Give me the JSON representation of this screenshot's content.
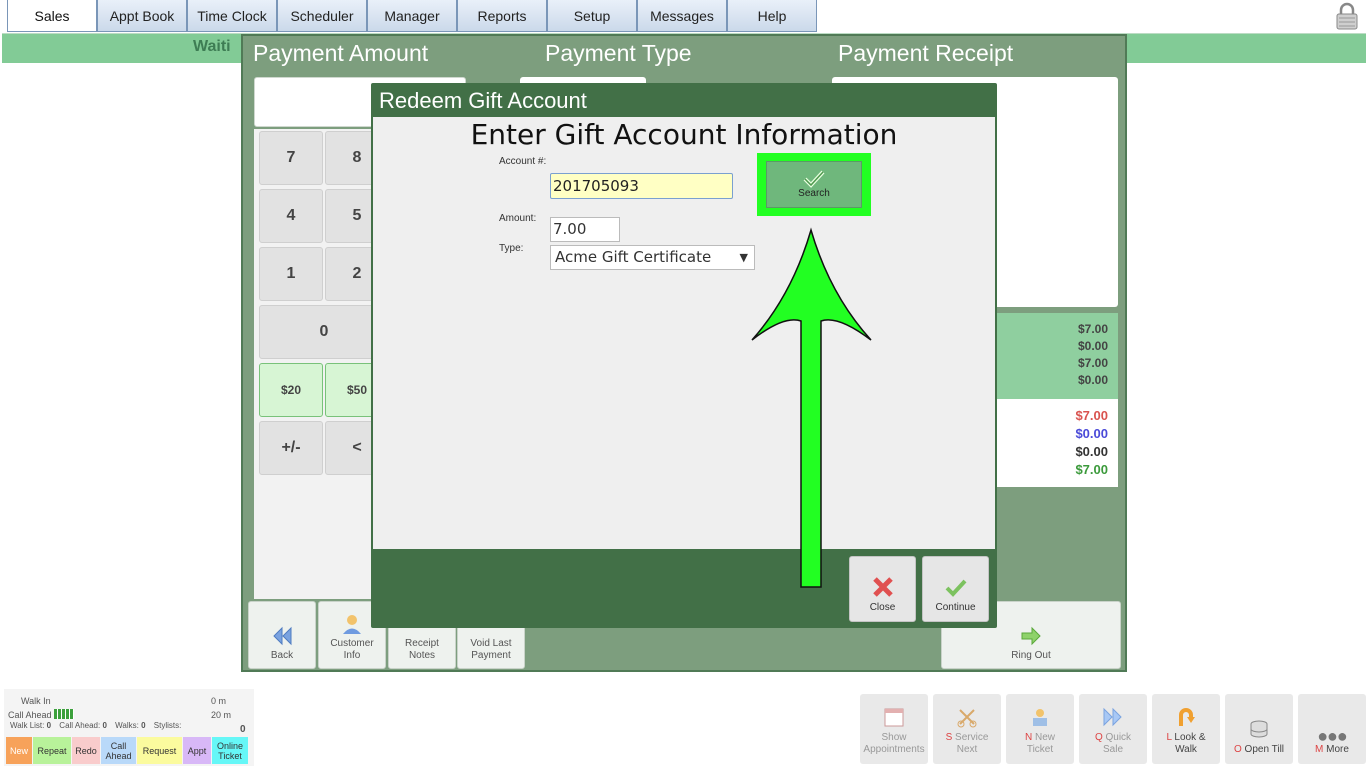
{
  "tabs": [
    "Sales",
    "Appt Book",
    "Time Clock",
    "Scheduler",
    "Manager",
    "Reports",
    "Setup",
    "Messages",
    "Help"
  ],
  "waiting_label": "Waiti",
  "payment": {
    "amount_header": "Payment Amount",
    "type_header": "Payment Type",
    "receipt_header": "Payment Receipt",
    "keys": [
      "7",
      "8",
      "4",
      "5",
      "1",
      "2",
      "0",
      "$20",
      "$50",
      "+/-",
      "<"
    ],
    "summary_green": [
      "$7.00",
      "$0.00",
      "$7.00",
      "$0.00"
    ],
    "summary_white": [
      "$7.00",
      "$0.00",
      "$0.00",
      "$7.00"
    ],
    "actions": {
      "back": "Back",
      "customer_info": [
        "Customer",
        "Info"
      ],
      "receipt_notes": [
        "Receipt",
        "Notes"
      ],
      "void_last": [
        "Void Last",
        "Payment"
      ],
      "ring_out": "Ring Out"
    }
  },
  "modal": {
    "title": "Redeem Gift Account",
    "heading": "Enter Gift Account Information",
    "account_label": "Account #:",
    "account_value": "201705093",
    "amount_label": "Amount:",
    "amount_value": "7.00",
    "type_label": "Type:",
    "type_value": "Acme Gift Certificate",
    "search_label": "Search",
    "close_label": "Close",
    "continue_label": "Continue"
  },
  "status": {
    "walk_in": "Walk In",
    "walk_in_time": "0 m",
    "call_ahead": "Call Ahead",
    "call_ahead_time": "20 m",
    "walk_list": "Walk List:",
    "walk_list_count": "0",
    "call_ahead_count_label": "Call Ahead:",
    "call_ahead_count": "0",
    "walks": "Walks:",
    "walks_count": "0",
    "stylists": "Stylists:",
    "total": "0"
  },
  "chips": [
    "New",
    "Repeat",
    "Redo",
    "Call Ahead",
    "Request",
    "Appt",
    "Online Ticket"
  ],
  "bottom_buttons": {
    "show_appts": [
      "Show",
      "Appointments"
    ],
    "service_next": {
      "key": "S",
      "label": "Service",
      "line2": "Next"
    },
    "new_ticket": {
      "key": "N",
      "label": "New",
      "line2": "Ticket"
    },
    "quick_sale": {
      "key": "Q",
      "label": "Quick",
      "line2": "Sale"
    },
    "look_walk": {
      "key": "L",
      "label": "Look &",
      "line2": "Walk"
    },
    "open_till": {
      "key": "O",
      "label": "Open Till"
    },
    "more": {
      "key": "M",
      "label": "More"
    }
  },
  "colors": {
    "modal_green": "#427047",
    "highlight_green": "#22ff22",
    "receipt_red": "#d9534f",
    "receipt_blue": "#4a4ad8",
    "receipt_green": "#3b9a3b"
  }
}
